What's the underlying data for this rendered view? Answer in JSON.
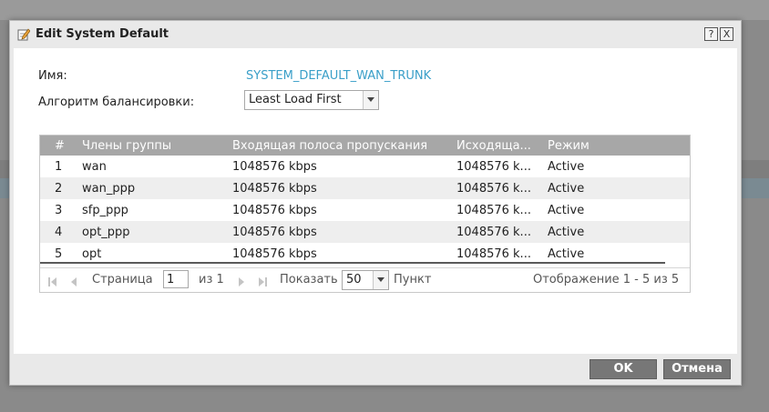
{
  "dialog": {
    "title": "Edit System Default",
    "help_label": "?",
    "close_label": "X"
  },
  "form": {
    "name_label": "Имя:",
    "name_value": "SYSTEM_DEFAULT_WAN_TRUNK",
    "algorithm_label": "Алгоритм балансировки:",
    "algorithm_value": "Least Load First"
  },
  "table": {
    "columns": [
      "#",
      "Члены группы",
      "Входящая полоса пропускания",
      "Исходяща...",
      "Режим"
    ],
    "rows": [
      [
        "1",
        "wan",
        "1048576 kbps",
        "1048576 k...",
        "Active"
      ],
      [
        "2",
        "wan_ppp",
        "1048576 kbps",
        "1048576 k...",
        "Active"
      ],
      [
        "3",
        "sfp_ppp",
        "1048576 kbps",
        "1048576 k...",
        "Active"
      ],
      [
        "4",
        "opt_ppp",
        "1048576 kbps",
        "1048576 k...",
        "Active"
      ],
      [
        "5",
        "opt",
        "1048576 kbps",
        "1048576 k...",
        "Active"
      ]
    ]
  },
  "pager": {
    "page_label": "Страница",
    "page_value": "1",
    "of_label": "из 1",
    "show_label": "Показать",
    "per_page": "50",
    "items_label": "Пункт",
    "summary": "Отображение 1 - 5 из 5"
  },
  "buttons": {
    "ok": "OK",
    "cancel": "Отмена"
  }
}
